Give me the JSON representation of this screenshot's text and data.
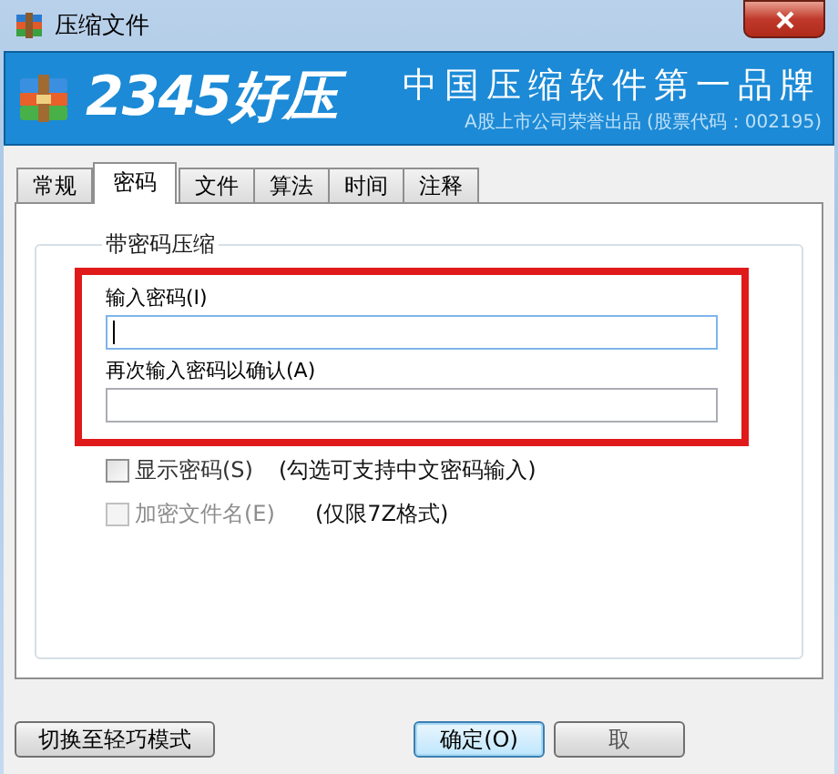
{
  "window": {
    "title": "压缩文件"
  },
  "banner": {
    "logo": "2345好压",
    "slogan": "中国压缩软件第一品牌",
    "subline": "A股上市公司荣誉出品 (股票代码：002195)"
  },
  "tabs": [
    {
      "label": "常规",
      "selected": false
    },
    {
      "label": "密码",
      "selected": true
    },
    {
      "label": "文件",
      "selected": false
    },
    {
      "label": "算法",
      "selected": false
    },
    {
      "label": "时间",
      "selected": false
    },
    {
      "label": "注释",
      "selected": false
    }
  ],
  "group": {
    "title": "带密码压缩",
    "fields": [
      {
        "label": "输入密码(I)",
        "focused": true
      },
      {
        "label": "再次输入密码以确认(A)",
        "focused": false
      }
    ],
    "options": [
      {
        "label": "显示密码(S)",
        "note": "(勾选可支持中文密码输入)",
        "checked": false,
        "disabled": false
      },
      {
        "label": "加密文件名(E)",
        "note": "(仅限7Z格式)",
        "checked": false,
        "disabled": true
      }
    ]
  },
  "buttons": [
    {
      "label": "切换至轻巧模式",
      "kind": "mode"
    },
    {
      "label": "确定(O)",
      "kind": "default"
    },
    {
      "label": "取",
      "kind": "plain"
    }
  ]
}
